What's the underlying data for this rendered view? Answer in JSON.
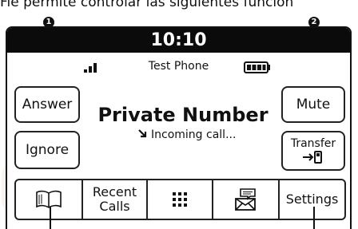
{
  "caption": {
    "text": "Fie permite controlar las siguientes funcion"
  },
  "callouts": {
    "one": "1",
    "two": "2"
  },
  "status_bar": {
    "time": "10:10",
    "phone_name": "Test Phone"
  },
  "call": {
    "title": "Private Number",
    "subtitle": "Incoming call..."
  },
  "buttons": {
    "answer": "Answer",
    "ignore": "Ignore",
    "mute": "Mute",
    "transfer": "Transfer"
  },
  "bottom_bar": {
    "recent_calls_line1": "Recent",
    "recent_calls_line2": "Calls",
    "settings": "Settings"
  },
  "icons": {
    "signal": "signal-icon",
    "battery": "battery-icon",
    "incoming_arrow": "incoming-arrow-icon",
    "transfer_handset": "transfer-handset-icon",
    "book": "book-icon",
    "keypad": "keypad-icon",
    "message": "message-icon"
  }
}
